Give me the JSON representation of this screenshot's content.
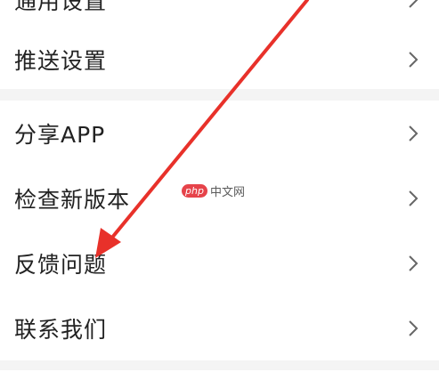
{
  "settings": {
    "top_item": {
      "label": "通用设置"
    },
    "push_item": {
      "label": "推送设置"
    },
    "items": [
      {
        "label": "分享APP"
      },
      {
        "label": "检查新版本"
      },
      {
        "label": "反馈问题"
      },
      {
        "label": "联系我们"
      }
    ]
  },
  "watermark": {
    "badge": "php",
    "text": "中文网"
  },
  "colors": {
    "background": "#f4f4f4",
    "row": "#ffffff",
    "text": "#222222",
    "chevron": "#666666",
    "arrow": "#e8312a"
  },
  "icons": {
    "row_chevron": "chevron-right-icon",
    "annotation": "red-arrow-annotation"
  }
}
